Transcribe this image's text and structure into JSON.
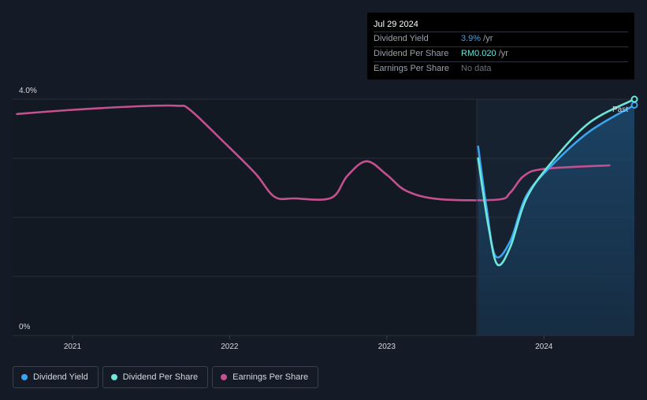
{
  "tooltip": {
    "date": "Jul 29 2024",
    "rows": [
      {
        "label": "Dividend Yield",
        "value": "3.9%",
        "unit": " /yr",
        "color": "#3ba3f0"
      },
      {
        "label": "Dividend Per Share",
        "value": "RM0.020",
        "unit": " /yr",
        "color": "#6ee6d9"
      },
      {
        "label": "Earnings Per Share",
        "value": "No data",
        "unit": "",
        "color": "#6b717b"
      }
    ]
  },
  "past_label": "Past",
  "legend": [
    {
      "label": "Dividend Yield",
      "color": "#3ba3f0"
    },
    {
      "label": "Dividend Per Share",
      "color": "#6ee6d9"
    },
    {
      "label": "Earnings Per Share",
      "color": "#c5508f"
    }
  ],
  "chart_data": {
    "type": "line",
    "x_ticks": [
      "2021",
      "2022",
      "2023",
      "2024"
    ],
    "y_ticks": [
      "4.0%",
      "0%"
    ],
    "ylim": [
      0,
      4.0
    ],
    "xlim": [
      "2020-08-15",
      "2024-07-29"
    ],
    "past_region_start": "2023-07-29",
    "grid": true,
    "series": [
      {
        "name": "Earnings Per Share",
        "color": "#c5508f",
        "points": [
          [
            "2020-08-25",
            3.75
          ],
          [
            "2021-01-01",
            3.82
          ],
          [
            "2021-06-01",
            3.88
          ],
          [
            "2021-09-01",
            3.89
          ],
          [
            "2021-10-01",
            3.82
          ],
          [
            "2021-12-15",
            3.3
          ],
          [
            "2022-03-01",
            2.75
          ],
          [
            "2022-04-15",
            2.35
          ],
          [
            "2022-06-01",
            2.32
          ],
          [
            "2022-08-25",
            2.33
          ],
          [
            "2022-10-01",
            2.7
          ],
          [
            "2022-11-15",
            2.95
          ],
          [
            "2023-01-01",
            2.72
          ],
          [
            "2023-02-15",
            2.45
          ],
          [
            "2023-05-01",
            2.31
          ],
          [
            "2023-09-15",
            2.3
          ],
          [
            "2023-10-15",
            2.42
          ],
          [
            "2023-11-15",
            2.7
          ],
          [
            "2024-01-01",
            2.82
          ],
          [
            "2024-06-01",
            2.88
          ]
        ]
      },
      {
        "name": "Dividend Yield",
        "color": "#3ba3f0",
        "points": [
          [
            "2023-08-01",
            3.2
          ],
          [
            "2023-08-20",
            2.2
          ],
          [
            "2023-09-10",
            1.35
          ],
          [
            "2023-10-15",
            1.6
          ],
          [
            "2023-11-20",
            2.35
          ],
          [
            "2024-01-15",
            2.85
          ],
          [
            "2024-04-15",
            3.45
          ],
          [
            "2024-07-29",
            3.9
          ]
        ]
      },
      {
        "name": "Dividend Per Share",
        "color": "#6ee6d9",
        "points": [
          [
            "2023-08-01",
            3.0
          ],
          [
            "2023-08-25",
            1.85
          ],
          [
            "2023-09-15",
            1.2
          ],
          [
            "2023-10-15",
            1.5
          ],
          [
            "2023-11-20",
            2.3
          ],
          [
            "2024-01-15",
            2.9
          ],
          [
            "2024-04-15",
            3.6
          ],
          [
            "2024-07-29",
            4.0
          ]
        ]
      }
    ]
  }
}
